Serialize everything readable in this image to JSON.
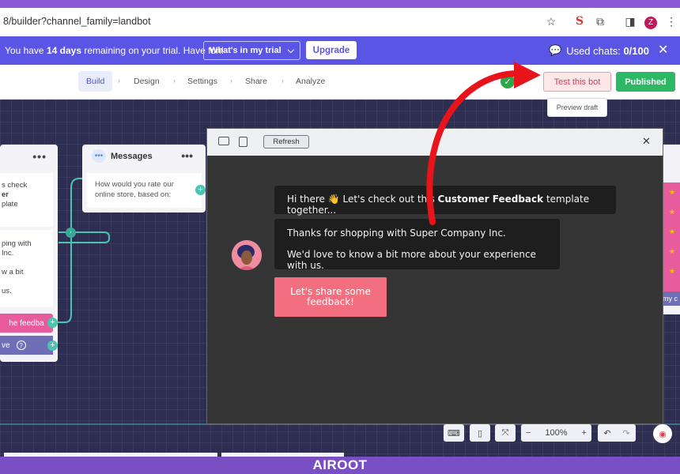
{
  "browser": {
    "url": "8/builder?channel_family=landbot",
    "profile_initial": "Z"
  },
  "trial_banner": {
    "text_prefix": "You have ",
    "days": "14 days",
    "text_suffix": " remaining on your trial. Have fun!",
    "whats_in_trial": "What's in my trial",
    "upgrade": "Upgrade",
    "used_chats_label": "Used chats: ",
    "used_chats_value": "0/100"
  },
  "nav_tabs": [
    "Build",
    "Design",
    "Settings",
    "Share",
    "Analyze"
  ],
  "header_actions": {
    "test": "Test this bot",
    "published": "Published",
    "tooltip": "Preview draft"
  },
  "left_node": {
    "lines1": [
      "s check",
      "er",
      "plate"
    ],
    "lines2": [
      "ping with",
      "Inc.",
      "",
      "w a bit",
      "",
      "us."
    ],
    "pink": "he feedba",
    "purple": "ve"
  },
  "messages_node": {
    "title": "Messages",
    "text": "How would you rate our online store, based on:"
  },
  "right_node": {
    "partial": "my c"
  },
  "preview": {
    "refresh": "Refresh",
    "msg1_prefix": "Hi there 👋  Let's check out this ",
    "msg1_bold": "Customer Feedback",
    "msg1_suffix": " template together...",
    "msg2_line1": "Thanks for shopping with Super Company Inc.",
    "msg2_line2": "We'd love to know a bit more about your experience with us.",
    "cta": "Let's share some feedback!"
  },
  "toolbar": {
    "zoom": "100%"
  },
  "brand": "AIROOT",
  "colors": {
    "banner": "#5b55e6",
    "published": "#2db866",
    "cta": "#f36f80",
    "arrow": "#e8141b"
  }
}
